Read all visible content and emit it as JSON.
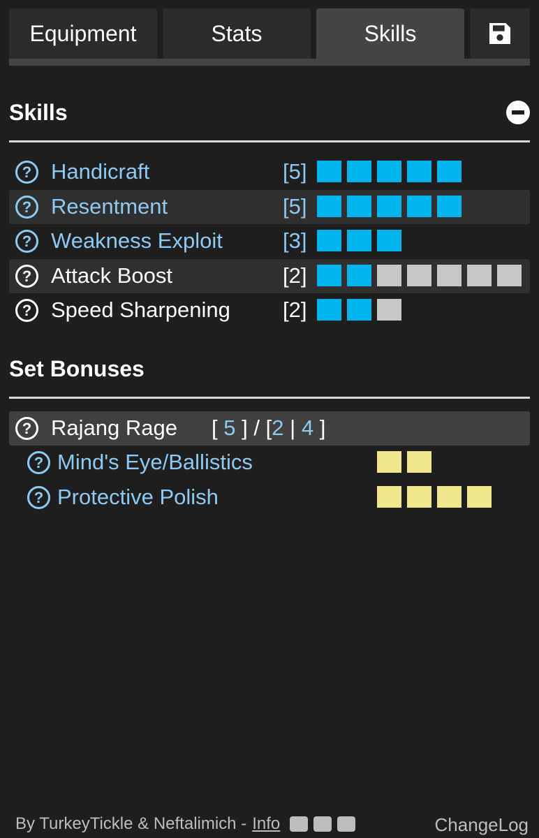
{
  "tabs": [
    {
      "label": "Equipment",
      "active": false
    },
    {
      "label": "Stats",
      "active": false
    },
    {
      "label": "Skills",
      "active": true
    },
    {
      "icon": "save-icon"
    }
  ],
  "skills_section": {
    "title": "Skills",
    "collapse_icon": "minus-circle-icon",
    "rows": [
      {
        "name": "Handicraft",
        "level": "[5]",
        "filled": 5,
        "max": 5,
        "color": "#8ec9f2"
      },
      {
        "name": "Resentment",
        "level": "[5]",
        "filled": 5,
        "max": 5,
        "color": "#8ec9f2"
      },
      {
        "name": "Weakness Exploit",
        "level": "[3]",
        "filled": 3,
        "max": 3,
        "color": "#8ec9f2"
      },
      {
        "name": "Attack Boost",
        "level": "[2]",
        "filled": 2,
        "max": 7,
        "color": "#ffffff"
      },
      {
        "name": "Speed Sharpening",
        "level": "[2]",
        "filled": 2,
        "max": 3,
        "color": "#ffffff"
      }
    ]
  },
  "set_bonuses": {
    "title": "Set Bonuses",
    "set": {
      "name": "Rajang Rage",
      "open_bracket": "[",
      "pieces": "5",
      "close_bracket": "]",
      "slash": "/",
      "threshold_open": "[",
      "threshold_1": "2",
      "sep": "|",
      "threshold_2": "4",
      "threshold_close": "]"
    },
    "bonuses": [
      {
        "name": "Mind's Eye/Ballistics",
        "pips": 2
      },
      {
        "name": "Protective Polish",
        "pips": 4
      }
    ]
  },
  "footer": {
    "credit": "By TurkeyTickle & Neftalimich -",
    "info": "Info",
    "icons": [
      "github-icon",
      "discord-icon",
      "twitter-icon"
    ],
    "changelog": "ChangeLog"
  },
  "colors": {
    "background": "#1e1e1e",
    "pip_on": "#00b4f0",
    "pip_off": "#c7c7c7",
    "set_pip": "#f0e68c",
    "link_blue": "#8ec9f2"
  }
}
